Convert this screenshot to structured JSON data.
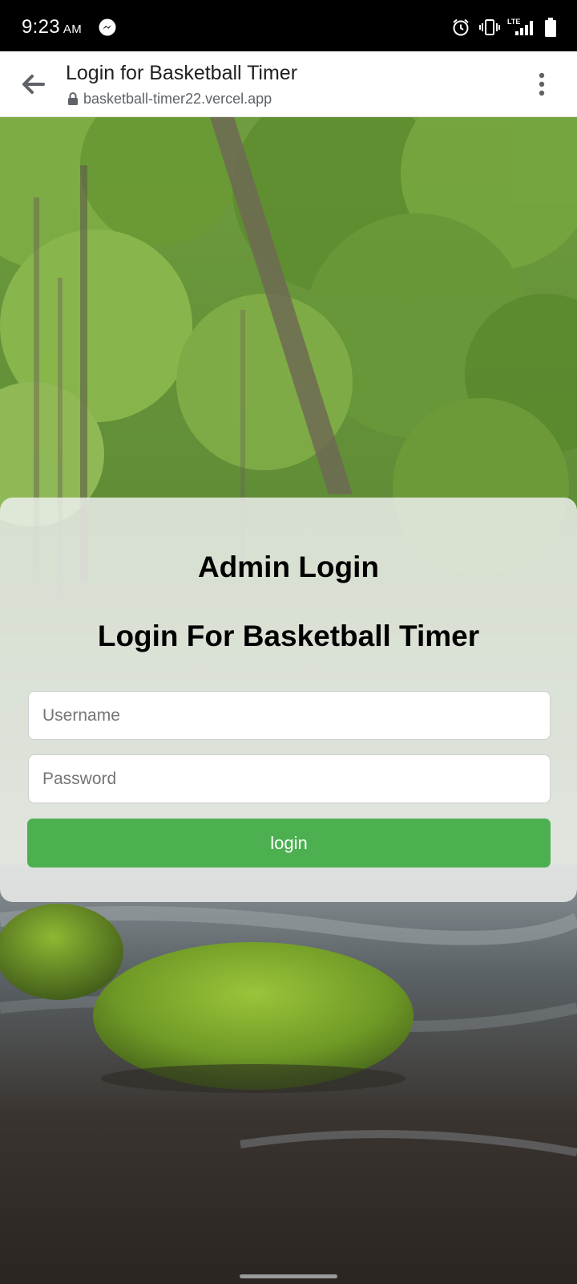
{
  "status_bar": {
    "time": "9:23",
    "ampm": "AM",
    "icons": [
      "messenger-icon",
      "alarm-icon",
      "vibrate-icon",
      "lte-signal-icon",
      "battery-icon"
    ],
    "lte_label": "LTE"
  },
  "browser": {
    "title": "Login for Basketball Timer",
    "url": "basketball-timer22.vercel.app",
    "icons": [
      "back-arrow-icon",
      "lock-icon",
      "more-vert-icon"
    ]
  },
  "login": {
    "heading": "Admin Login",
    "subheading": "Login For Basketball Timer",
    "username_placeholder": "Username",
    "username_value": "",
    "password_placeholder": "Password",
    "password_value": "",
    "button_label": "login",
    "button_color": "#4caf50"
  },
  "colors": {
    "panel_bg": "#eef0ee",
    "accent": "#4caf50"
  }
}
